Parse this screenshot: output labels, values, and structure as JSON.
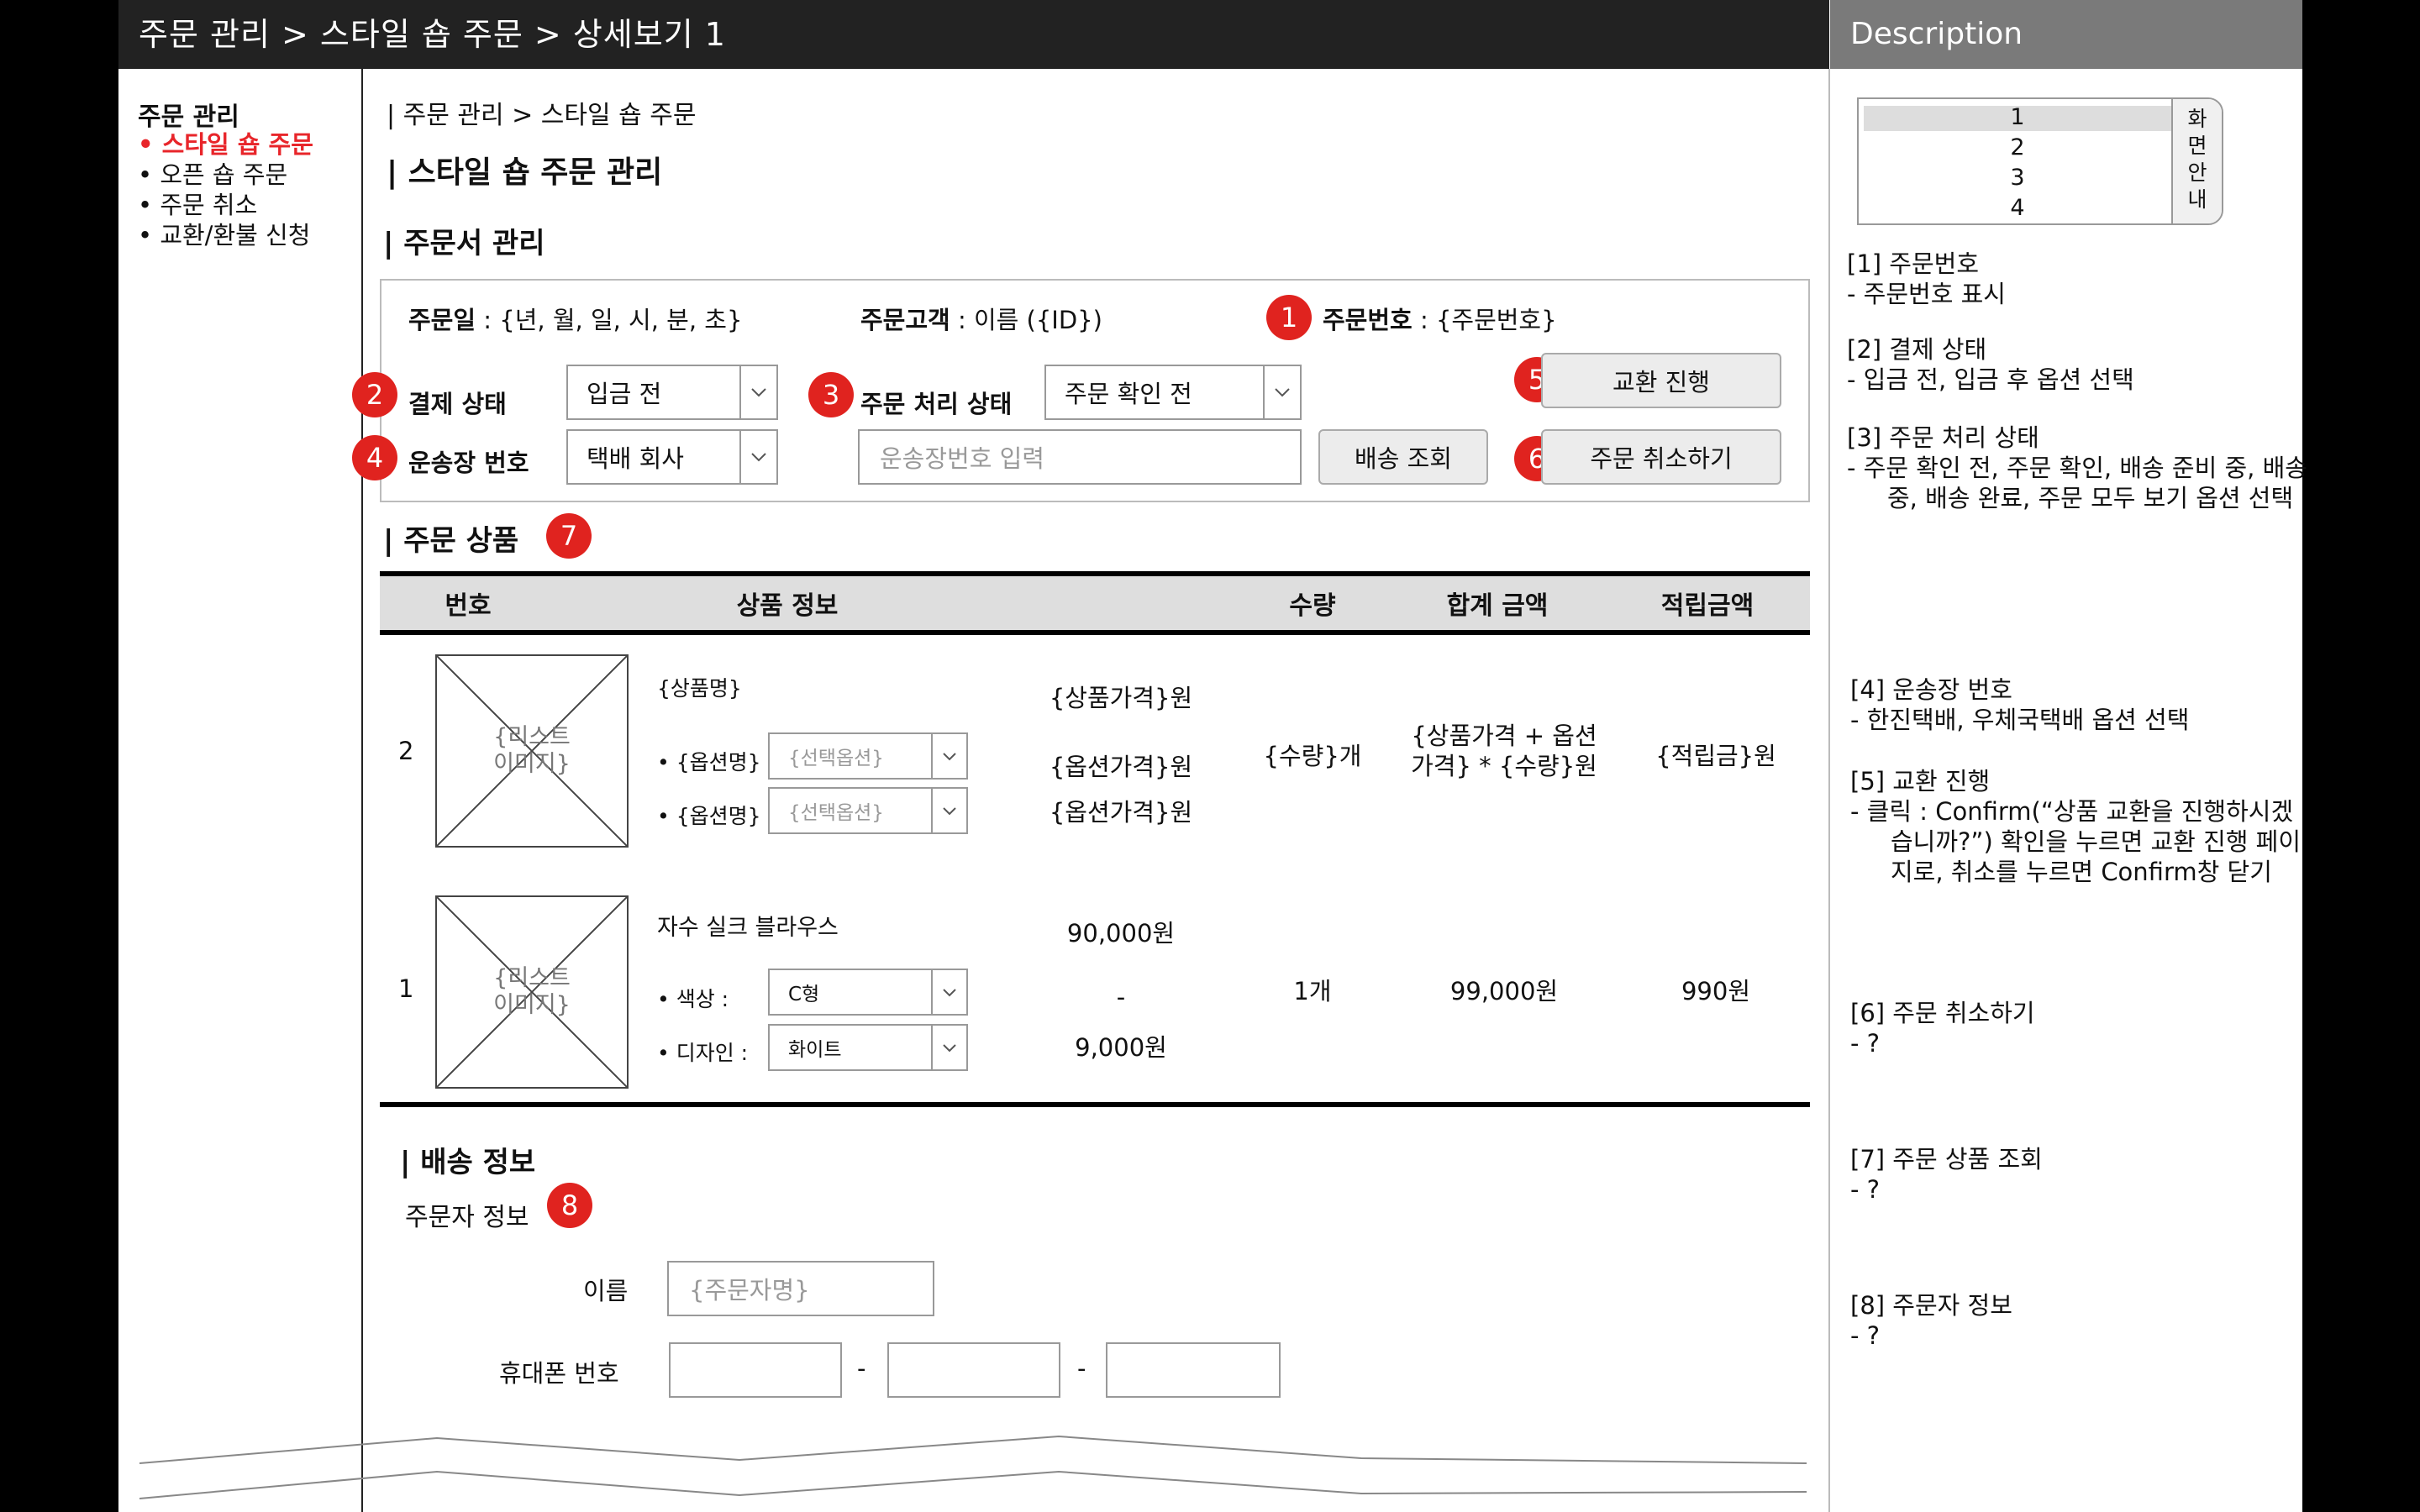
{
  "header": {
    "breadcrumb_title": "주문 관리 > 스타일 숍 주문 > 상세보기 1",
    "description_title": "Description"
  },
  "sidebar": {
    "title": "주문 관리",
    "items": [
      {
        "label": "• 스타일 숍 주문",
        "active": true
      },
      {
        "label": "• 오픈 숍 주문",
        "active": false
      },
      {
        "label": "• 주문 취소",
        "active": false
      },
      {
        "label": "• 교환/환불 신청",
        "active": false
      }
    ]
  },
  "main": {
    "breadcrumb": "| 주문 관리 > 스타일 숍 주문",
    "page_title": "| 스타일 숍 주문 관리",
    "order_section_title": "| 주문서 관리",
    "order_date_label": "주문일",
    "order_date_value": " : {년, 월, 일, 시, 분, 초}",
    "customer_label": "주문고객",
    "customer_value": " : 이름 ({ID})",
    "order_no_label": "주문번호",
    "order_no_value": " : {주문번호}",
    "payment_status_label": "결제 상태",
    "payment_status_value": "입금 전",
    "order_status_label": "주문 처리 상태",
    "order_status_value": "주문 확인 전",
    "waybill_label": "운송장 번호",
    "courier_value": "택배 회사",
    "waybill_placeholder": "운송장번호 입력",
    "track_button": "배송 조회",
    "exchange_button": "교환 진행",
    "cancel_button": "주문 취소하기",
    "products_title": "| 주문 상품",
    "table_headers": [
      "번호",
      "상품 정보",
      "수량",
      "합계 금액",
      "적립금액"
    ],
    "rows": [
      {
        "no": "2",
        "image_caption": "{리스트\n이미지}",
        "name": "{상품명}",
        "price": "{상품가격}원",
        "options": [
          {
            "label": "• {옵션명}",
            "value": "{선택옵션}",
            "price": "{옵션가격}원"
          },
          {
            "label": "• {옵션명}",
            "value": "{선택옵션}",
            "price": "{옵션가격}원"
          }
        ],
        "qty": "{수량}개",
        "total": "{상품가격 + 옵션\n가격} * {수량}원",
        "points": "{적립금}원"
      },
      {
        "no": "1",
        "image_caption": "{리스트\n이미지}",
        "name": "자수 실크 블라우스",
        "price": "90,000원",
        "options": [
          {
            "label": "• 색상 :",
            "value": "C형",
            "price": "-"
          },
          {
            "label": "• 디자인 :",
            "value": "화이트",
            "price": "9,000원"
          }
        ],
        "qty": "1개",
        "total": "99,000원",
        "points": "990원"
      }
    ],
    "delivery_title": "| 배송 정보",
    "orderer_info_label": "주문자 정보",
    "name_label": "이름",
    "name_placeholder": "{주문자명}",
    "phone_label": "휴대폰 번호",
    "phone_sep": "-"
  },
  "badges": [
    "1",
    "2",
    "3",
    "4",
    "5",
    "6",
    "7",
    "8"
  ],
  "description": {
    "screen_list": [
      "1",
      "2",
      "3",
      "4"
    ],
    "screen_guide": [
      "화",
      "면",
      "안",
      "내"
    ],
    "items": [
      {
        "title": "[1] 주문번호",
        "detail": "-    주문번호 표시"
      },
      {
        "title": "[2] 결제 상태",
        "detail": "-    입금 전, 입금 후 옵션 선택"
      },
      {
        "title": "[3] 주문 처리 상태",
        "detail": "-    주문 확인 전, 주문 확인, 배송 준비 중, 배송 중, 배송 완료, 주문 모두 보기 옵션 선택"
      },
      {
        "title": "[4] 운송장 번호",
        "detail": "-    한진택배, 우체국택배 옵션 선택"
      },
      {
        "title": "[5] 교환 진행",
        "detail": "-    클릭 : Confirm(“상품 교환을 진행하시겠습니까?”) 확인을 누르면 교환 진행 페이지로, 취소를 누르면 Confirm창 닫기"
      },
      {
        "title": "[6] 주문 취소하기",
        "detail": "-    ?"
      },
      {
        "title": "[7] 주문 상품 조회",
        "detail": "-    ?"
      },
      {
        "title": "[8] 주문자 정보",
        "detail": "-    ?"
      }
    ]
  },
  "colors": {
    "accent": "#e0231f",
    "header_bg": "#222222",
    "desc_header_bg": "#7a7a7a",
    "table_head_bg": "#dedede"
  }
}
